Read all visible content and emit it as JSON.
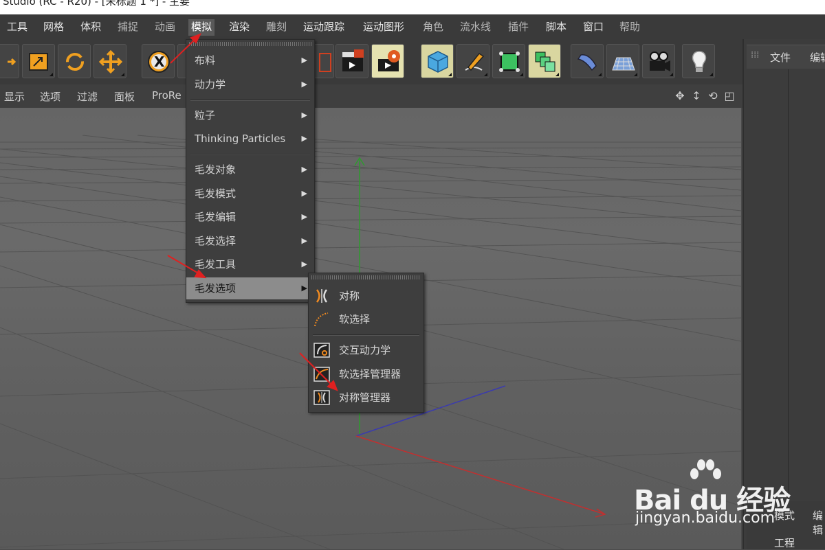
{
  "window": {
    "title": "Studio (RC - R20) - [未标题 1 *] - 主要"
  },
  "menubar": {
    "items": [
      "工具",
      "网格",
      "体积",
      "捕捉",
      "动画",
      "模拟",
      "渲染",
      "雕刻",
      "运动跟踪",
      "运动图形",
      "角色",
      "流水线",
      "插件",
      "脚本",
      "窗口",
      "帮助"
    ],
    "active": "模拟"
  },
  "viewport_menu": {
    "items": [
      "显示",
      "选项",
      "过滤",
      "面板",
      "ProRe"
    ]
  },
  "simulate_menu": {
    "items": [
      {
        "label": "布料",
        "submenu": true
      },
      {
        "label": "动力学",
        "submenu": true
      },
      {
        "label": "粒子",
        "submenu": true
      },
      {
        "label": "Thinking Particles",
        "submenu": true
      },
      {
        "label": "毛发对象",
        "submenu": true
      },
      {
        "label": "毛发模式",
        "submenu": true
      },
      {
        "label": "毛发编辑",
        "submenu": true
      },
      {
        "label": "毛发选择",
        "submenu": true
      },
      {
        "label": "毛发工具",
        "submenu": true
      },
      {
        "label": "毛发选项",
        "submenu": true,
        "highlighted": true
      }
    ]
  },
  "hair_options_submenu": {
    "items": [
      {
        "label": "对称",
        "icon": "symmetry-icon"
      },
      {
        "label": "软选择",
        "icon": "soft-selection-icon"
      },
      {
        "label": "交互动力学",
        "icon": "interactive-dynamics-icon"
      },
      {
        "label": "软选择管理器",
        "icon": "soft-selection-manager-icon"
      },
      {
        "label": "对称管理器",
        "icon": "symmetry-manager-icon"
      }
    ]
  },
  "right_panel": {
    "tabs": [
      "文件",
      "编辑"
    ],
    "bottom_tabs": [
      "模式",
      "编辑"
    ],
    "bottom_item": "工程"
  },
  "watermark": {
    "logo": "Bai du 经验",
    "url": "jingyan.baidu.com"
  },
  "colors": {
    "axis_x": "#c03030",
    "axis_y": "#2f9a2f",
    "axis_z": "#3a3ab0",
    "annotation_arrow": "#e02020",
    "menu_highlight": "#8c8c8c"
  }
}
